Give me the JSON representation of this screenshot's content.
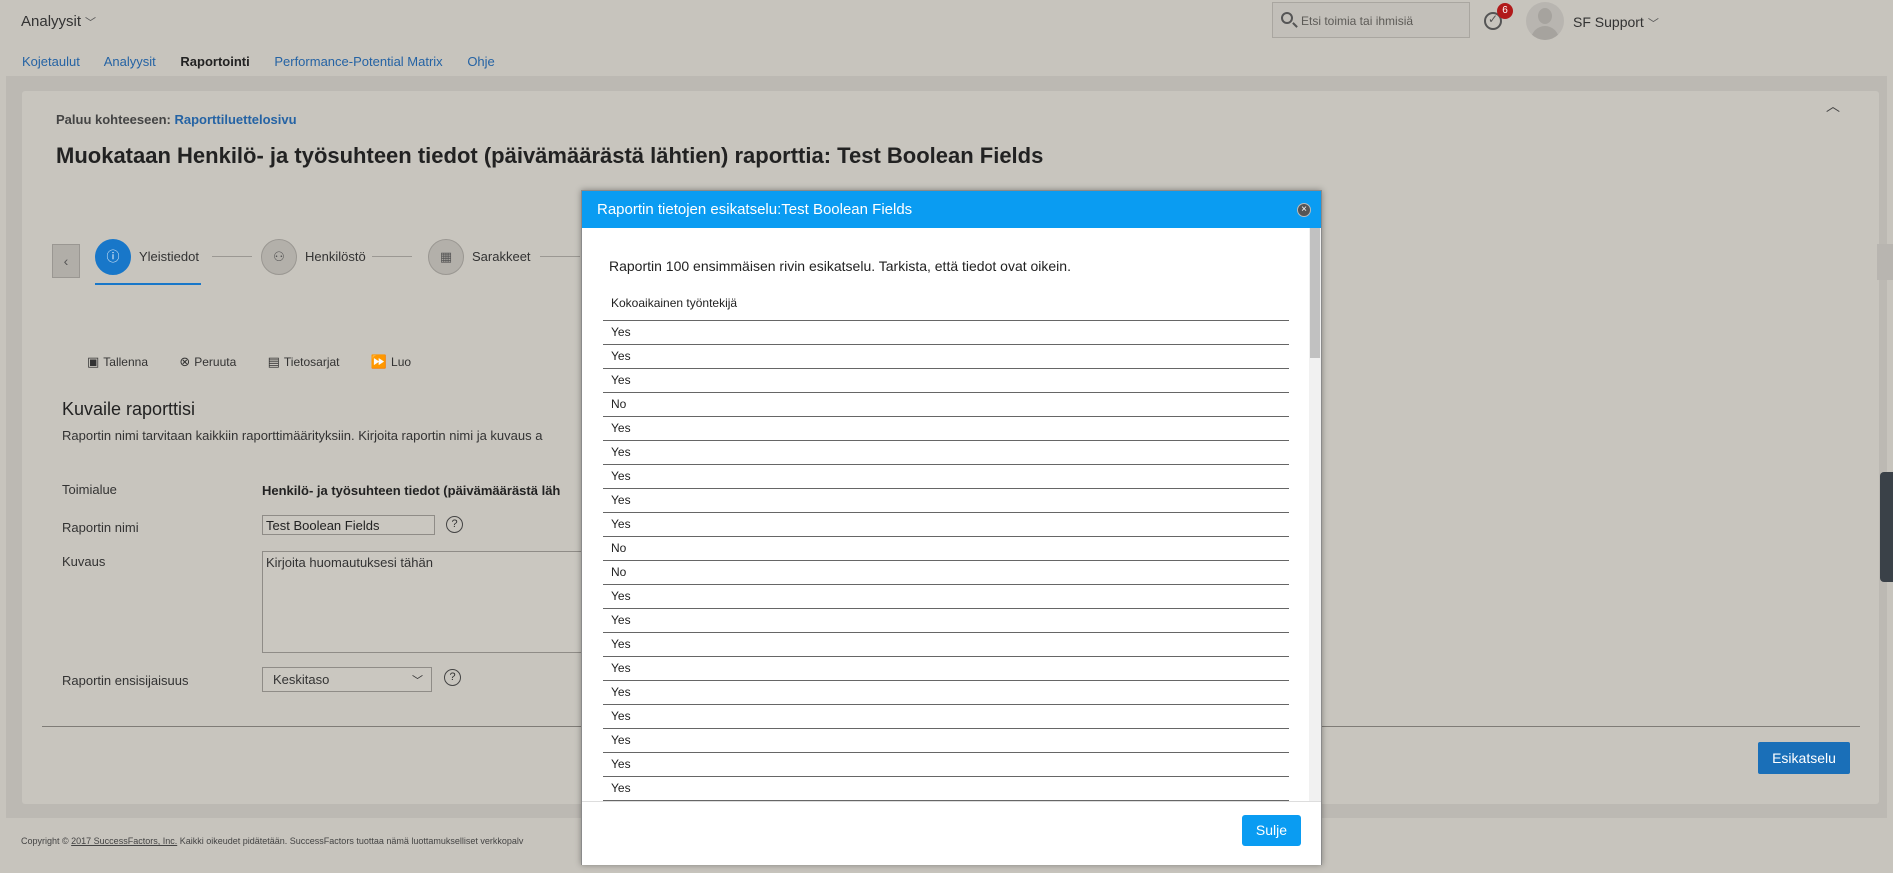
{
  "header": {
    "app_switcher": "Analyysit",
    "search_placeholder": "Etsi toimia tai ihmisiä",
    "notification_count": "6",
    "user_name": "SF Support"
  },
  "nav": {
    "items": [
      "Kojetaulut",
      "Analyysit",
      "Raportointi",
      "Performance-Potential Matrix",
      "Ohje"
    ],
    "active": "Raportointi"
  },
  "page": {
    "back_prefix": "Paluu kohteeseen:",
    "back_link": "Raporttiluettelosivu",
    "title": "Muokataan Henkilö- ja työsuhteen tiedot (päivämäärästä lähtien) raporttia: Test Boolean Fields"
  },
  "wizard": {
    "steps": [
      "Yleistiedot",
      "Henkilöstö",
      "Sarakkeet"
    ]
  },
  "toolbar": {
    "save": "Tallenna",
    "cancel": "Peruuta",
    "datasets": "Tietosarjat",
    "create": "Luo"
  },
  "form": {
    "section_title": "Kuvaile raporttisi",
    "section_desc": "Raportin nimi tarvitaan kaikkiin raporttimäärityksiin. Kirjoita raportin nimi ja kuvaus a",
    "domain_label": "Toimialue",
    "domain_value": "Henkilö- ja työsuhteen tiedot (päivämäärästä läh",
    "name_label": "Raportin nimi",
    "name_value": "Test Boolean Fields",
    "desc_label": "Kuvaus",
    "desc_placeholder": "Kirjoita huomautuksesi tähän",
    "priority_label": "Raportin ensisijaisuus",
    "priority_value": "Keskitaso"
  },
  "preview_button": "Esikatselu",
  "footer": {
    "prefix": "Copyright © ",
    "company": "2017 SuccessFactors, Inc.",
    "rest": " Kaikki oikeudet pidätetään. SuccessFactors tuottaa nämä luottamukselliset verkkopalv"
  },
  "modal": {
    "title": "Raportin tietojen esikatselu:Test Boolean Fields",
    "intro": "Raportin 100 ensimmäisen rivin esikatselu. Tarkista, että tiedot ovat oikein.",
    "column_header": "Kokoaikainen työntekijä",
    "rows": [
      "Yes",
      "Yes",
      "Yes",
      "No",
      "Yes",
      "Yes",
      "Yes",
      "Yes",
      "Yes",
      "No",
      "No",
      "Yes",
      "Yes",
      "Yes",
      "Yes",
      "Yes",
      "Yes",
      "Yes",
      "Yes",
      "Yes"
    ],
    "close_label": "Sulje"
  }
}
